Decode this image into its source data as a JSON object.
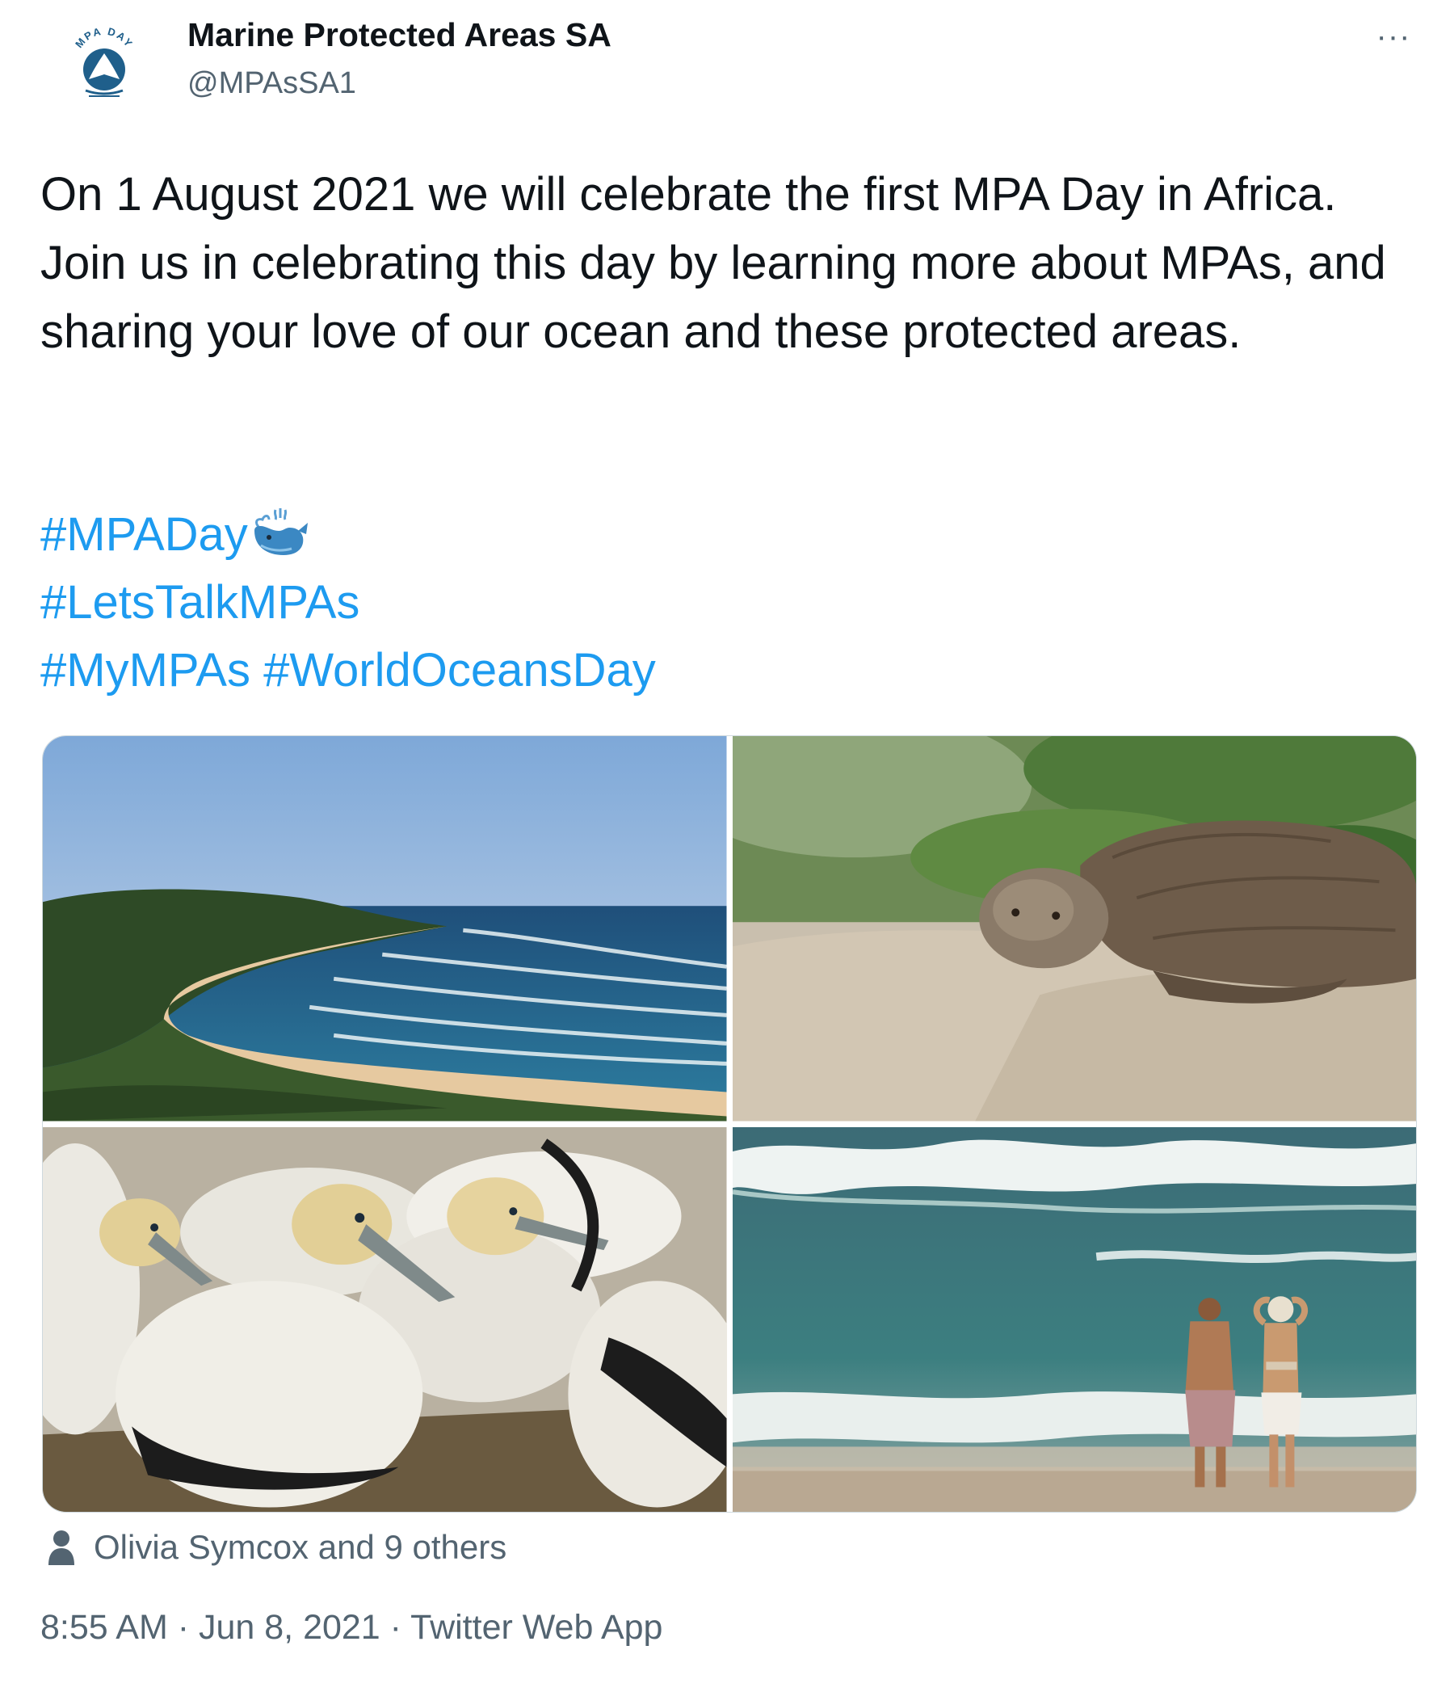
{
  "author": {
    "display_name": "Marine Protected Areas SA",
    "handle": "@MPAsSA1",
    "avatar_icon": "mpa-day-logo",
    "avatar_text": "MPA DAY"
  },
  "more_options_icon": "ellipsis-icon",
  "more_options_label": "···",
  "tweet_text": "On 1 August 2021 we will celebrate the first MPA Day in Africa. Join us in celebrating this day by learning more about MPAs, and sharing your love of our ocean and these protected areas.",
  "hashtags": {
    "line1": "#MPADay",
    "line1_emoji": "spouting-whale-icon",
    "line2": "#LetsTalkMPAs",
    "line3a": "#MyMPAs",
    "line3b": "#WorldOceansDay"
  },
  "media": [
    {
      "subject": "coastline-beach-photo"
    },
    {
      "subject": "sea-turtle-on-sand-photo"
    },
    {
      "subject": "cape-gannets-colony-photo"
    },
    {
      "subject": "people-watching-waves-photo"
    }
  ],
  "liked_by": {
    "icon": "person-icon",
    "text": "Olivia Symcox and 9 others"
  },
  "meta": {
    "time": "8:55 AM",
    "separator": " · ",
    "date": "Jun 8, 2021",
    "source": "Twitter Web App"
  },
  "colors": {
    "link": "#1d9bf0",
    "text": "#0f1419",
    "secondary": "#536471"
  }
}
